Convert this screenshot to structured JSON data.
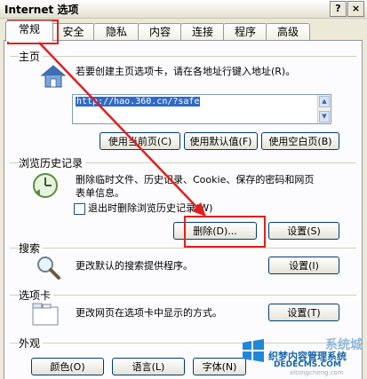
{
  "window": {
    "title": "Internet 选项",
    "help_label": "?",
    "close_label": "×"
  },
  "tabs": [
    {
      "label": "常规"
    },
    {
      "label": "安全"
    },
    {
      "label": "隐私"
    },
    {
      "label": "内容"
    },
    {
      "label": "连接"
    },
    {
      "label": "程序"
    },
    {
      "label": "高级"
    }
  ],
  "homepage": {
    "group_label": "主页",
    "description": "若要创建主页选项卡，请在各地址行键入地址(R)。",
    "url": "http://hao.360.cn/?safe",
    "use_current_label": "使用当前页(C)",
    "use_default_label": "使用默认值(F)",
    "use_blank_label": "使用空白页(B)"
  },
  "history": {
    "group_label": "浏览历史记录",
    "description_line1": "删除临时文件、历史记录、Cookie、保存的密码和网页",
    "description_line2": "表单信息。",
    "checkbox_label": "退出时删除浏览历史记录(W)",
    "delete_label": "删除(D)...",
    "settings_label": "设置(S)"
  },
  "search": {
    "group_label": "搜索",
    "description": "更改默认的搜索提供程序。",
    "settings_label": "设置(I)"
  },
  "tabs_section": {
    "group_label": "选项卡",
    "description": "更改网页在选项卡中显示的方式。",
    "settings_label": "设置(T)"
  },
  "appearance": {
    "group_label": "外观",
    "colors_label": "颜色(O)",
    "languages_label": "语言(L)",
    "fonts_label": "字体(N)"
  },
  "watermark": {
    "line1": "系统城",
    "line2": "织梦内容管理系统",
    "line3": "DEDECMS.COM",
    "line4": "xitongcheng.com"
  },
  "colors": {
    "annotation_red": "#E02020",
    "selection_blue": "#316AC5"
  }
}
